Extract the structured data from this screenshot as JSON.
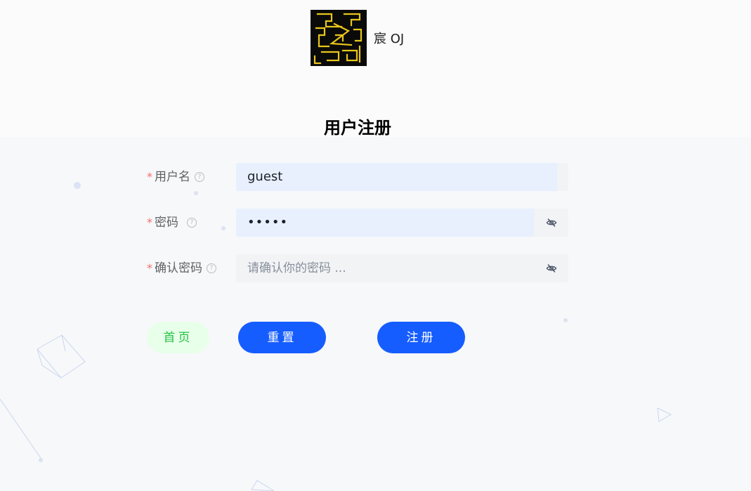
{
  "brand": {
    "name": "宸 OJ"
  },
  "page": {
    "title": "用户注册"
  },
  "form": {
    "required_mark": "*",
    "help_glyph": "?",
    "username": {
      "label": "用户名",
      "value": "guest"
    },
    "password": {
      "label": "密码",
      "value": "•••••"
    },
    "confirm": {
      "label": "确认密码",
      "value": "",
      "placeholder": "请确认你的密码 ..."
    }
  },
  "actions": {
    "home_label": "首页",
    "reset_label": "重置",
    "register_label": "注册"
  },
  "icons": {
    "help": "question-circle",
    "password_toggle": "eye-slash"
  },
  "colors": {
    "primary": "#165dff",
    "home_bg": "#e8ffea",
    "home_text": "#23c343",
    "required": "#f56c6c",
    "autofill": "#e8f0fe",
    "input_bg": "#f2f3f5",
    "logo_line": "#e8c61a"
  }
}
